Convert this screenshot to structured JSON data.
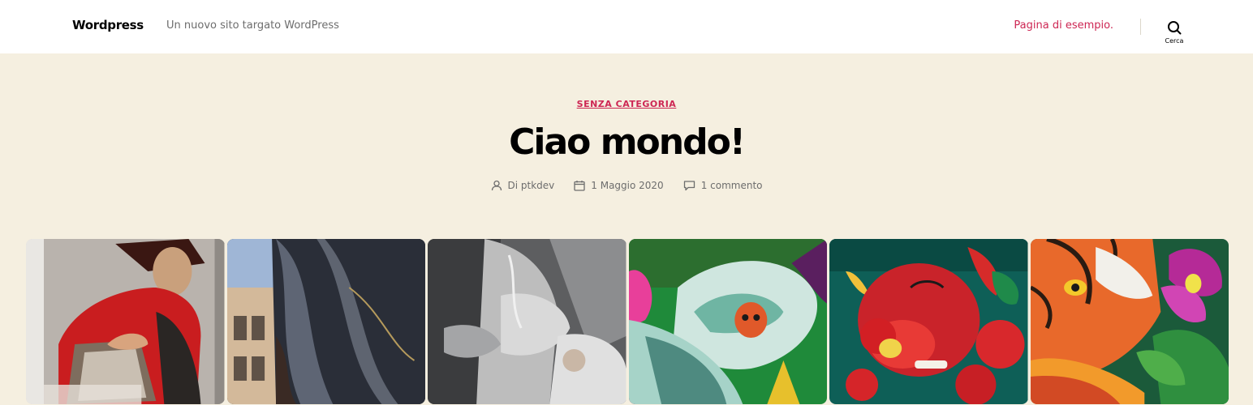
{
  "header": {
    "site_title": "Wordpress",
    "site_description": "Un nuovo sito targato WordPress",
    "menu": [
      {
        "label": "Pagina di esempio."
      }
    ],
    "search_label": "Cerca",
    "accent_color": "#cd2653"
  },
  "post": {
    "category": "SENZA CATEGORIA",
    "title": "Ciao mondo!",
    "meta": {
      "author": "Di ptkdev",
      "date": "1 Maggio 2020",
      "comments": "1 commento"
    }
  },
  "gallery": {
    "images": [
      {
        "icon": "mural-red-figure-image"
      },
      {
        "icon": "mural-abstract-building-image"
      },
      {
        "icon": "mural-grey-hand-image"
      },
      {
        "icon": "mural-green-skull-image"
      },
      {
        "icon": "mural-red-tomato-image"
      },
      {
        "icon": "mural-tiger-flower-image"
      }
    ]
  },
  "colors": {
    "background": "#f5efe0",
    "header_bg": "#ffffff",
    "meta_text": "#6d6d6d"
  }
}
